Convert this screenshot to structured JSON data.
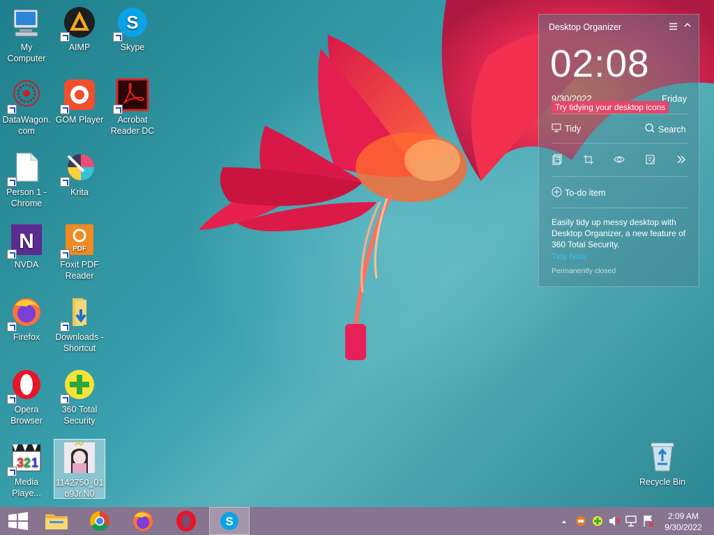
{
  "desktop_icons": [
    {
      "label": "My\nComputer",
      "icon": "computer-icon"
    },
    {
      "label": "AIMP",
      "icon": "aimp-icon"
    },
    {
      "label": "Skype",
      "icon": "skype-icon"
    },
    {
      "label": "DataWagon.\ncom",
      "icon": "datawagon-icon"
    },
    {
      "label": "GOM Player",
      "icon": "gom-player-icon"
    },
    {
      "label": "Acrobat\nReader DC",
      "icon": "acrobat-icon"
    },
    {
      "label": "Person 1 -\nChrome",
      "icon": "document-icon"
    },
    {
      "label": "Krita",
      "icon": "krita-icon"
    },
    {
      "label": "NVDA",
      "icon": "nvda-icon"
    },
    {
      "label": "Foxit PDF\nReader",
      "icon": "foxit-icon"
    },
    {
      "label": "Firefox",
      "icon": "firefox-icon"
    },
    {
      "label": "Downloads -\nShortcut",
      "icon": "folder-icon"
    },
    {
      "label": "Opera\nBrowser",
      "icon": "opera-icon"
    },
    {
      "label": "360 Total\nSecurity",
      "icon": "360-security-icon"
    },
    {
      "label": "Media\nPlaye...",
      "icon": "media-player-icon"
    },
    {
      "label": "1142750_01\no9Jr.N0",
      "icon": "image-file-icon"
    },
    {
      "label": "Recycle Bin",
      "icon": "recycle-bin-icon"
    }
  ],
  "organizer": {
    "title": "Desktop Organizer",
    "clock": "02:08",
    "date": "9/30/2022",
    "day": "Friday",
    "tip": "Try tidying your desktop icons",
    "tidy_label": "Tidy",
    "search_label": "Search",
    "todo_label": "To-do item",
    "promo_text": "Easily tidy up messy desktop with Desktop Organizer, a new feature of 360 Total Security.",
    "tidy_now": "Tidy Now",
    "closed_text": "Permanently closed",
    "tip_color": "#e2476a",
    "link_color": "#3ac0f0"
  },
  "taskbar": {
    "items": [
      "start-button",
      "file-explorer",
      "chrome",
      "firefox",
      "opera",
      "skype"
    ],
    "active_item": "skype",
    "time": "2:09 AM",
    "date": "9/30/2022"
  }
}
